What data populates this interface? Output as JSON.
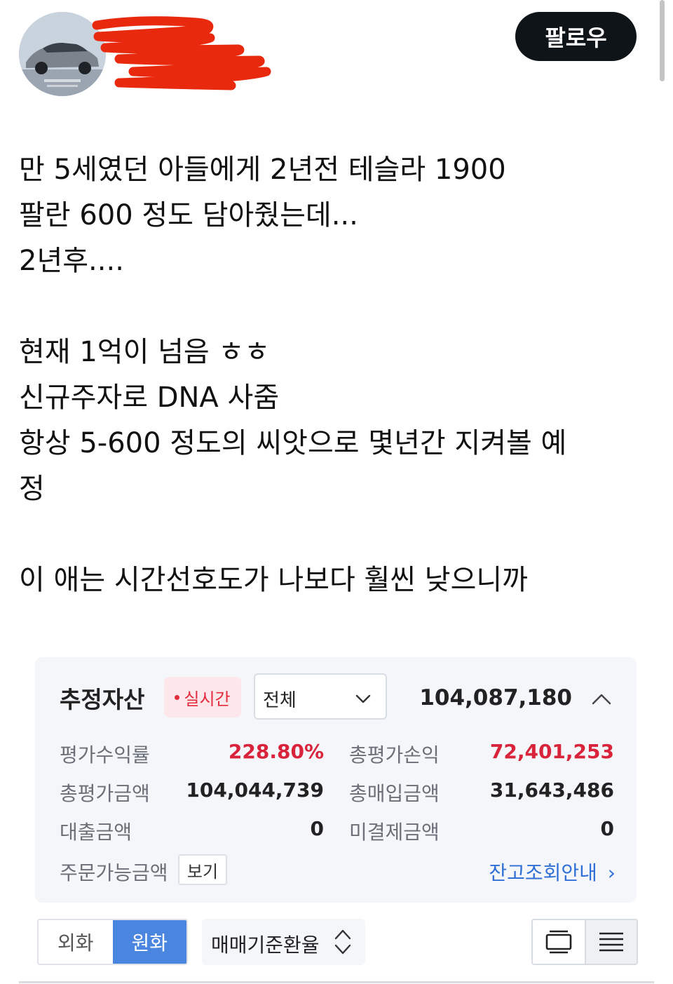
{
  "header": {
    "follow_label": "팔로우"
  },
  "post": {
    "lines": [
      "만 5세였던 아들에게 2년전 테슬라 1900",
      "팔란 600 정도 담아줬는데...",
      "2년후....",
      "현재 1억이 넘음 ㅎㅎ",
      "신규주자로 DNA 사줌",
      "항상 5-600 정도의 씨앗으로 몇년간 지켜볼 예",
      "정",
      "이 애는 시간선호도가 나보다 훨씬 낮으니까"
    ]
  },
  "account": {
    "title": "추정자산",
    "realtime_label": "실시간",
    "filter_value": "전체",
    "total": "104,087,180",
    "rows": [
      {
        "label": "평가수익률",
        "value": "228.80%"
      },
      {
        "label": "총평가손익",
        "value": "72,401,253"
      },
      {
        "label": "총평가금액",
        "value": "104,044,739"
      },
      {
        "label": "총매입금액",
        "value": "31,643,486"
      },
      {
        "label": "대출금액",
        "value": "0"
      },
      {
        "label": "미결제금액",
        "value": "0"
      },
      {
        "label": "주문가능금액",
        "value": ""
      }
    ],
    "view_label": "보기",
    "balance_link": "잔고조회안내"
  },
  "controls": {
    "currency_tabs": [
      "외화",
      "원화"
    ],
    "active_currency": "원화",
    "rate_label": "매매기준환율"
  },
  "colors": {
    "follow_bg": "#0f1419",
    "profit_red": "#d8233a",
    "link_blue": "#2f6fd6",
    "active_tab": "#4a86e0",
    "card_bg": "#f4f6fa"
  }
}
